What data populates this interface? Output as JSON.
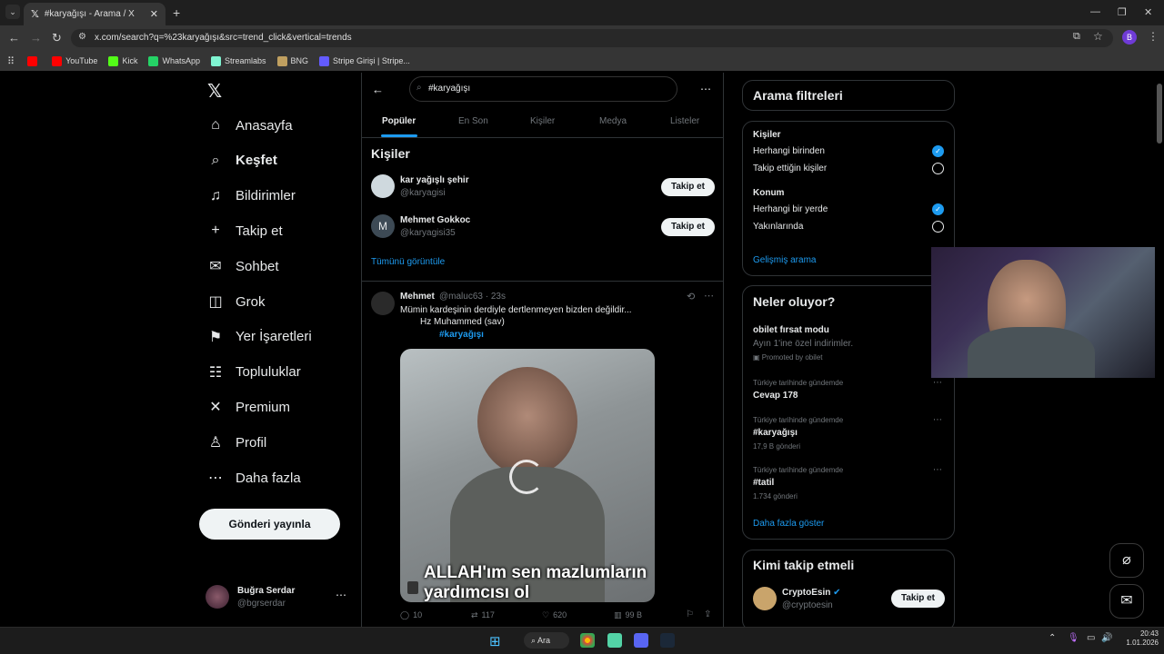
{
  "browser": {
    "tab_title": "#karyağışı - Arama / X",
    "url": "x.com/search?q=%23karyağışı&src=trend_click&vertical=trends",
    "profile_letter": "B",
    "bookmarks": [
      {
        "label": "",
        "color": "#ff0000"
      },
      {
        "label": "YouTube",
        "color": "#ff0000"
      },
      {
        "label": "Kick",
        "color": "#53fc18"
      },
      {
        "label": "WhatsApp",
        "color": "#25d366"
      },
      {
        "label": "Streamlabs",
        "color": "#80f5d2"
      },
      {
        "label": "BNG",
        "color": "#c0a060"
      },
      {
        "label": "Stripe Girişi | Stripe...",
        "color": "#635bff"
      }
    ]
  },
  "nav": {
    "items": [
      {
        "label": "Anasayfa",
        "icon": "home-icon",
        "glyph": "⌂"
      },
      {
        "label": "Keşfet",
        "icon": "search-icon",
        "glyph": "⌕"
      },
      {
        "label": "Bildirimler",
        "icon": "bell-icon",
        "glyph": "♫"
      },
      {
        "label": "Takip et",
        "icon": "follow-icon",
        "glyph": "+"
      },
      {
        "label": "Sohbet",
        "icon": "mail-icon",
        "glyph": "✉"
      },
      {
        "label": "Grok",
        "icon": "grok-icon",
        "glyph": "◫"
      },
      {
        "label": "Yer İşaretleri",
        "icon": "bookmark-icon",
        "glyph": "⚑"
      },
      {
        "label": "Topluluklar",
        "icon": "communities-icon",
        "glyph": "☷"
      },
      {
        "label": "Premium",
        "icon": "x-premium-icon",
        "glyph": "✕"
      },
      {
        "label": "Profil",
        "icon": "profile-icon",
        "glyph": "♙"
      },
      {
        "label": "Daha fazla",
        "icon": "more-icon",
        "glyph": "⋯"
      }
    ],
    "post_button": "Gönderi yayınla",
    "account_name": "Buğra Serdar",
    "account_handle": "@bgrserdar"
  },
  "search": {
    "query": "#karyağışı",
    "tabs": [
      "Popüler",
      "En Son",
      "Kişiler",
      "Medya",
      "Listeler"
    ]
  },
  "people": {
    "heading": "Kişiler",
    "users": [
      {
        "name": "kar yağışlı şehir",
        "handle": "@karyagisi",
        "follow": "Takip et"
      },
      {
        "name": "Mehmet Gokkoc",
        "handle": "@karyagisi35",
        "follow": "Takip et",
        "initial": "M"
      }
    ],
    "show_all": "Tümünü görüntüle"
  },
  "post": {
    "author": "Mehmet",
    "handle_time": "@maluc63 · 23s",
    "line1": "Mümin kardeşinin derdiyle dertlenmeyen bizden değildir...",
    "line2": "Hz Muhammed (sav)",
    "hashtag": "#karyağışı",
    "video_caption": "ALLAH'ım sen mazlumların yardımcısı ol",
    "replies": "10",
    "reposts": "117",
    "likes": "620",
    "views": "99 B"
  },
  "filters": {
    "title": "Arama filtreleri",
    "people_label": "Kişiler",
    "people_options": [
      {
        "label": "Herhangi birinden",
        "checked": true
      },
      {
        "label": "Takip ettiğin kişiler",
        "checked": false
      }
    ],
    "location_label": "Konum",
    "location_options": [
      {
        "label": "Herhangi bir yerde",
        "checked": true
      },
      {
        "label": "Yakınlarında",
        "checked": false
      }
    ],
    "advanced": "Gelişmiş arama"
  },
  "trends": {
    "title": "Neler oluyor?",
    "promo_title": "obilet fırsat modu",
    "promo_sub": "Ayın 1'ine özel indirimler.",
    "promo_by": "Promoted by obilet",
    "items": [
      {
        "context": "Türkiye tarihinde gündemde",
        "name": "Cevap 178",
        "count": ""
      },
      {
        "context": "Türkiye tarihinde gündemde",
        "name": "#karyağışı",
        "count": "17,9 B gönderi"
      },
      {
        "context": "Türkiye tarihinde gündemde",
        "name": "#tatil",
        "count": "1.734 gönderi"
      }
    ],
    "show_more": "Daha fazla göster"
  },
  "who_to_follow": {
    "title": "Kimi takip etmeli",
    "name": "CryptoEsin",
    "handle": "@cryptoesin",
    "follow": "Takip et"
  },
  "taskbar": {
    "search": "Ara",
    "time": "20:43",
    "date": "1.01.2026"
  }
}
